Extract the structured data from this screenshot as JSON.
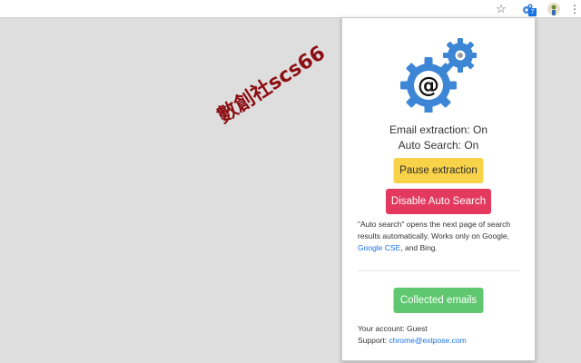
{
  "browser": {
    "star_icon": "star-icon",
    "extension_icon": "gears-icon",
    "extension_badge": "7",
    "avatar_icon": "profile-avatar",
    "menu_icon": "more-vert-icon"
  },
  "watermark": {
    "text": "數創社scs66"
  },
  "popup": {
    "logo_icon": "gears-at-sign-icon",
    "email_status": "Email extraction: On",
    "auto_status": "Auto Search: On",
    "pause_label": "Pause extraction",
    "disable_label": "Disable Auto Search",
    "info": {
      "part1": "\"Auto search\" opens the next page of search results automatically. Works only on Google, ",
      "link1": "Google CSE",
      "part2": ", and Bing."
    },
    "collected_label": "Collected emails",
    "account": "Your account: Guest",
    "support_label": "Support: ",
    "support_email": "chrome@extpose.com"
  },
  "colors": {
    "pause": "#f8d34a",
    "disable": "#e4395e",
    "collected": "#5fc76f",
    "link": "#1a73e8",
    "gear_blue": "#3d86d6"
  }
}
